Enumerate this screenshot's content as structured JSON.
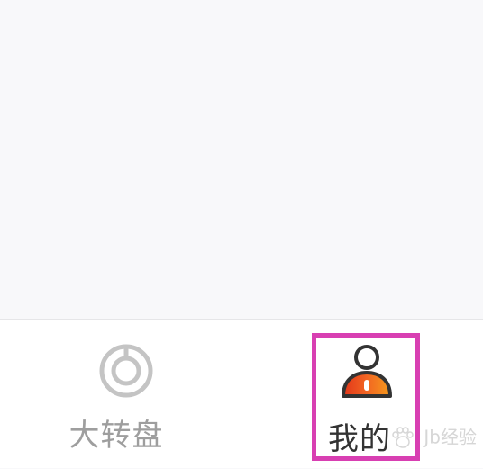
{
  "tabs": [
    {
      "label": "大转盘",
      "icon": "wheel-icon",
      "color": "#9e9e9e"
    },
    {
      "label": "我的",
      "icon": "profile-icon",
      "color": "#333333",
      "selected": true
    }
  ],
  "colors": {
    "background": "#f8f8fa",
    "tab_bar": "#ffffff",
    "highlight": "#d83fb2",
    "profile_accent": "#f0541c"
  },
  "watermark": {
    "text": "Jb经验"
  }
}
